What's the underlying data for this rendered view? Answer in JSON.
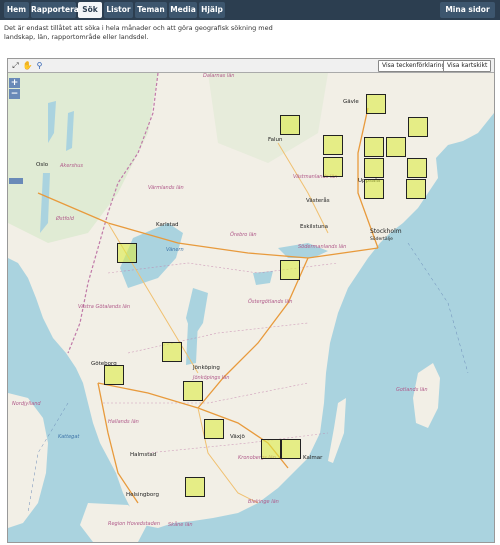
{
  "nav": {
    "items": [
      {
        "label": "Hem"
      },
      {
        "label": "Rapportera"
      },
      {
        "label": "Sök"
      },
      {
        "label": "Listor"
      },
      {
        "label": "Teman"
      },
      {
        "label": "Media"
      },
      {
        "label": "Hjälp"
      }
    ],
    "active_item": "Sök",
    "right_label": "Mina sidor"
  },
  "intro_text": "Det är endast tillåtet att söka i hela månader och att göra geografisk sökning med landskap, län, rapportområde eller landsdel.",
  "map_toolbar": {
    "legend_button": "Visa teckenförklaring",
    "print_button": "Visa kartskikt"
  },
  "zoom": {
    "in": "+",
    "out": "−"
  },
  "map_labels": {
    "dalarnas_lan": "Dalarnas län",
    "falun": "Falun",
    "gavle": "Gävle",
    "oslo": "Oslo",
    "akershus": "Akershus",
    "ostfold": "Østfold",
    "varmlands_lan": "Värmlands län",
    "karlstad": "Karlstad",
    "vanern": "Vänern",
    "vastmanlands_lan": "Västmanlands län",
    "vasteras": "Västerås",
    "orebro_lan": "Örebro län",
    "uppsala": "Uppsala",
    "eskilstuna": "Eskilstuna",
    "sodermanlands_lan": "Södermanlands län",
    "stockholm": "Stockholm",
    "sodertalje": "Södertälje",
    "stockholms_lan": "Stockholms län",
    "ostergotlands_lan": "Östergötlands län",
    "vastra_gotalands_lan": "Västra Götalands län",
    "goteborg": "Göteborg",
    "jonkoping": "Jönköping",
    "jonkopings_lan": "Jönköpings län",
    "nordjylland": "Nordjylland",
    "hallands_lan": "Hallands län",
    "vaxjo": "Växjö",
    "kronobergs_lan": "Kronobergs län",
    "kalmar": "Kalmar",
    "gotlands_lan": "Gotlands län",
    "halmstad": "Halmstad",
    "helsingborg": "Helsingborg",
    "region_hovedstaden": "Region Hovedstaden",
    "skane_lan": "Skåne län",
    "blekinge_lan": "Blekinge län",
    "kattegat": "Kattegat"
  }
}
